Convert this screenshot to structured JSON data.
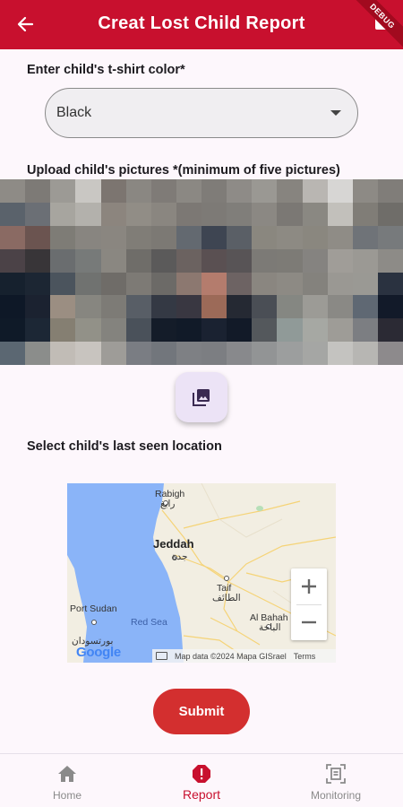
{
  "app_bar": {
    "title": "Creat Lost Child Report",
    "debug_badge": "DEBUG",
    "color": "#c8102e"
  },
  "tshirt_section": {
    "label": "Enter child's t-shirt color*",
    "selected_value": "Black"
  },
  "pictures_section": {
    "label": "Upload child's pictures *(minimum of five pictures)"
  },
  "location_section": {
    "label": "Select child's last seen location",
    "map": {
      "places": [
        "Rabigh",
        "رابغ",
        "Jeddah",
        "جدة",
        "Taif",
        "الطائف",
        "Al Bahah",
        "الباحة",
        "Red Sea",
        "Port Sudan",
        "بورتسودان"
      ],
      "logo": "Google",
      "attribution": "Map data ©2024 Mapa GISrael",
      "terms": "Terms",
      "zoom_in": "+",
      "zoom_out": "−"
    }
  },
  "submit": {
    "label": "Submit",
    "color": "#d32f2f"
  },
  "bottom_nav": {
    "items": [
      {
        "label": "Home",
        "icon": "home-icon"
      },
      {
        "label": "Report",
        "icon": "report-icon",
        "active": true
      },
      {
        "label": "Monitoring",
        "icon": "monitoring-icon"
      }
    ]
  }
}
